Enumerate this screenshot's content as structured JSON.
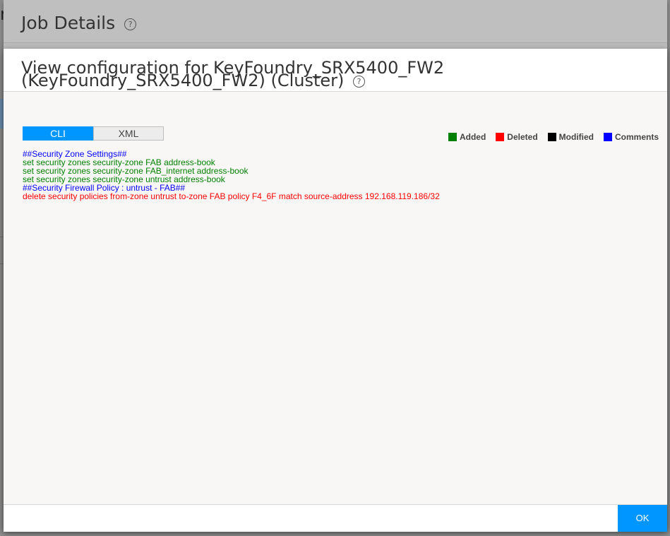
{
  "background": {
    "edge_text": "n"
  },
  "job_details": {
    "title": "Job Details",
    "help_icon": "?"
  },
  "view_config": {
    "title": "View configuration for KeyFoundry_SRX5400_FW2 (KeyFoundry_SRX5400_FW2) (Cluster)",
    "help_icon": "?",
    "tabs": [
      {
        "label": "CLI",
        "active": true
      },
      {
        "label": "XML",
        "active": false
      }
    ],
    "legend": [
      {
        "label": "Added",
        "color": "#008000"
      },
      {
        "label": "Deleted",
        "color": "#ff0000"
      },
      {
        "label": "Modified",
        "color": "#000000"
      },
      {
        "label": "Comments",
        "color": "#0000ff"
      }
    ],
    "lines": [
      {
        "text": "##Security Zone Settings##",
        "type": "comment",
        "color": "#0000ff"
      },
      {
        "text": "set security zones security-zone FAB address-book",
        "type": "added",
        "color": "#008000"
      },
      {
        "text": "set security zones security-zone FAB_internet address-book",
        "type": "added",
        "color": "#008000"
      },
      {
        "text": "set security zones security-zone untrust address-book",
        "type": "added",
        "color": "#008000"
      },
      {
        "text": "##Security Firewall Policy : untrust - FAB##",
        "type": "comment",
        "color": "#0000ff"
      },
      {
        "text": "delete security policies from-zone untrust to-zone FAB policy F4_6F match source-address 192.168.119.186/32",
        "type": "deleted",
        "color": "#ff0000"
      }
    ],
    "ok_label": "OK"
  }
}
